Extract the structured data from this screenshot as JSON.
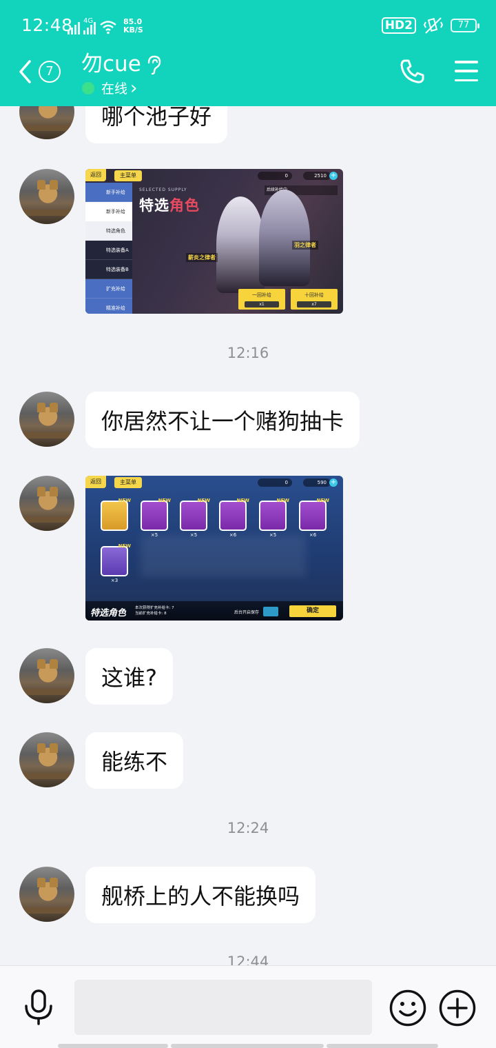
{
  "status_bar": {
    "time": "12:48",
    "net_speed_value": "85.0",
    "net_speed_unit": "KB/S",
    "network_label": "4G",
    "hd_label": "HD2",
    "battery": "77"
  },
  "header": {
    "unread_count": "7",
    "contact_name": "勿cue",
    "status_text": "在线",
    "status_chevron": "›",
    "colors": {
      "bar": "#12d4bd",
      "online_dot": "#3ce08a"
    }
  },
  "messages": {
    "m1_text": "哪个池子好",
    "ts1": "12:16",
    "m3_text": "你居然不让一个赌狗抽卡",
    "m5_text": "这谁?",
    "m6_text": "能练不",
    "ts2": "12:24",
    "m7_text": "舰桥上的人不能换吗",
    "ts3": "12:44"
  },
  "game1": {
    "back": "返回",
    "home": "主菜单",
    "resource1": "0",
    "resource2": "2510",
    "menu_items": [
      "新手补给",
      "新手补给",
      "特选角色",
      "特选装备A",
      "特选装备B",
      "扩充补给",
      "精准补给"
    ],
    "title_en": "SELECTED SUPPLY",
    "title_white": "特选",
    "title_red": "角色",
    "notice": "后续补给中",
    "char_label_1": "羽之律者",
    "char_label_2": "薪炎之律者",
    "pull_one": "一回补给",
    "pull_ten": "十回补给",
    "pull_one_cost": "x1",
    "pull_ten_cost": "x7"
  },
  "game2": {
    "back": "返回",
    "home": "主菜单",
    "resource1": "0",
    "resource2": "590",
    "new_tag": "NEW",
    "card_qtys": [
      "",
      "×5",
      "×5",
      "×6",
      "×5",
      "×6",
      "×3"
    ],
    "bottom_title": "特选角色",
    "bottom_info_1": "本次获得扩充补给卡: 7",
    "bottom_info_2": "当前扩充补给卡: 8",
    "tip": "后台开启保存",
    "confirm": "确定"
  },
  "input_bar": {
    "placeholder": ""
  },
  "icons": {
    "back": "chevron-left-icon",
    "ear": "ear-icon",
    "phone": "phone-icon",
    "menu": "hamburger-menu-icon",
    "mic": "microphone-icon",
    "emoji": "smiley-icon",
    "plus": "plus-circle-icon"
  }
}
